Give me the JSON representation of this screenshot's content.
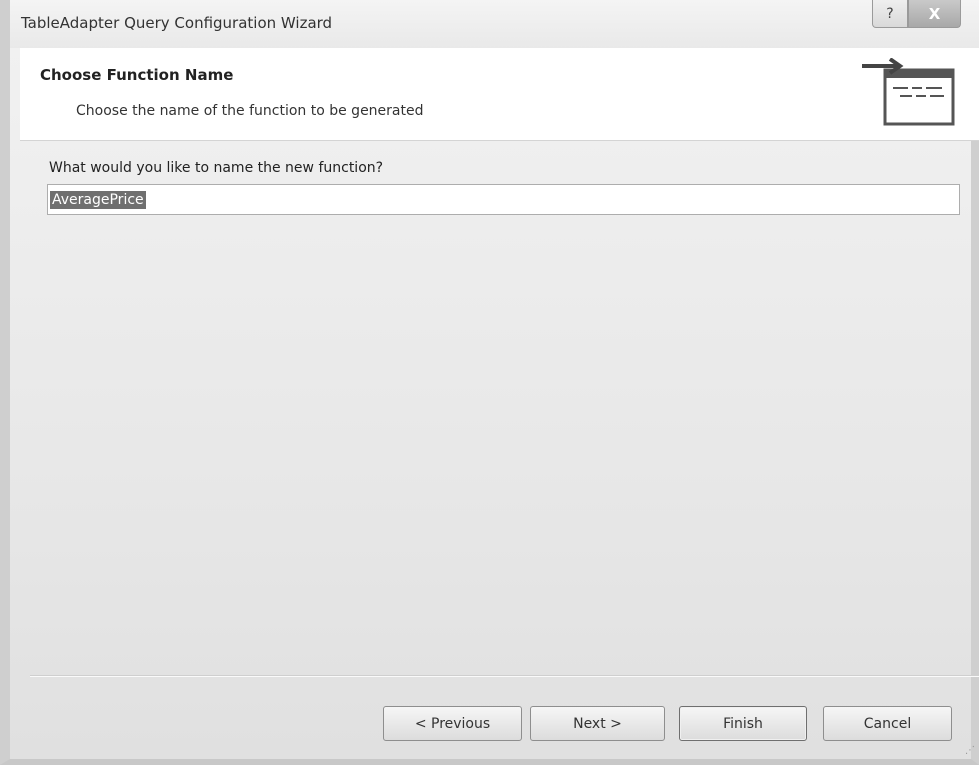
{
  "window": {
    "title": "TableAdapter Query Configuration Wizard",
    "help_label": "?",
    "close_label": "X"
  },
  "header": {
    "title": "Choose Function Name",
    "subtitle": "Choose the name of the function to be generated",
    "icon": "function-window-icon"
  },
  "form": {
    "question": "What would you like to name the new function?",
    "function_name": "AveragePrice"
  },
  "buttons": {
    "previous": "< Previous",
    "next": "Next >",
    "finish": "Finish",
    "cancel": "Cancel"
  },
  "colors": {
    "header_bg": "#ffffff",
    "body_bg": "#ececec",
    "selection": "#6f6f6f"
  }
}
